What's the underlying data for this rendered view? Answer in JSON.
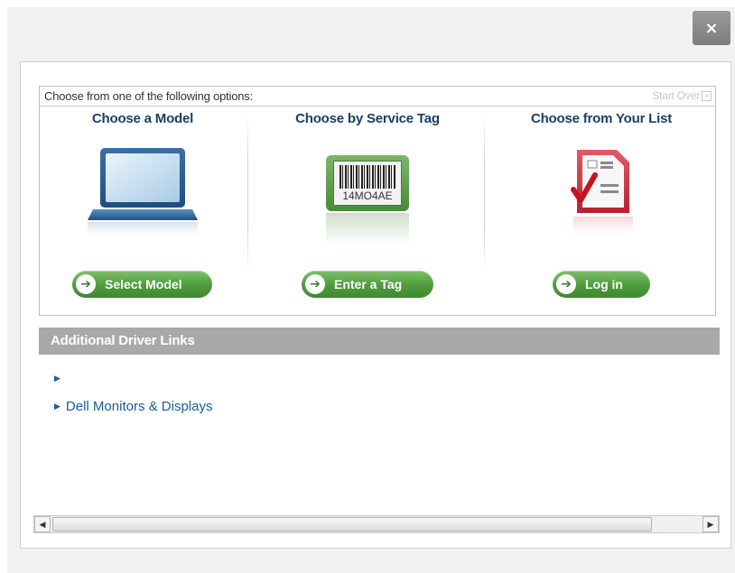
{
  "close_button": {
    "label": "×"
  },
  "options": {
    "header_text": "Choose from one of the following options:",
    "start_over_label": "Start Over",
    "columns": [
      {
        "title": "Choose a Model",
        "button_label": "Select Model",
        "icon": "laptop-icon"
      },
      {
        "title": "Choose by Service Tag",
        "button_label": "Enter a Tag",
        "icon": "service-tag-icon",
        "tag_text": "14MO4AE"
      },
      {
        "title": "Choose from Your List",
        "button_label": "Log in",
        "icon": "list-checklist-icon"
      }
    ]
  },
  "additional_links": {
    "title": "Additional Driver Links",
    "items": [
      {
        "label": ""
      },
      {
        "label": "Dell Monitors & Displays"
      }
    ]
  },
  "scrollbar": {
    "left_arrow": "◀",
    "right_arrow": "▶"
  },
  "colors": {
    "accent_green": "#4e9a3c",
    "title_blue": "#1a3f66",
    "link_blue": "#1a5c9c",
    "section_gray": "#a9a9a9"
  }
}
